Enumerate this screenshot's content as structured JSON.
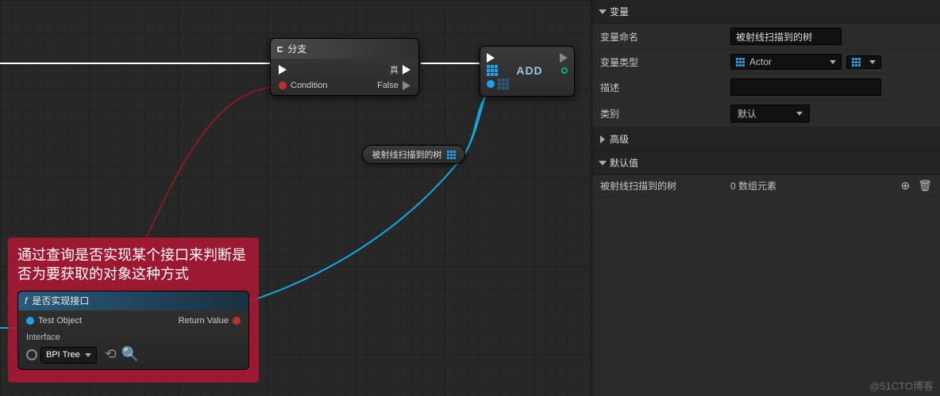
{
  "graph": {
    "branch": {
      "title": "分支",
      "condition": "Condition",
      "true": "真",
      "false": "False"
    },
    "add": {
      "label": "ADD"
    },
    "var_pill": "被射线扫描到的树",
    "note_text": "通过查询是否实现某个接口来判断是否为要获取的对象这种方式",
    "interface_check": {
      "title": "是否实现接口",
      "test_object": "Test Object",
      "return_value": "Return Value",
      "interface_label": "Interface",
      "interface_value": "BPI Tree"
    }
  },
  "details": {
    "sections": {
      "variable": "变量",
      "advanced": "高级",
      "default_val": "默认值"
    },
    "rows": {
      "name_label": "变量命名",
      "name_value": "被射线扫描到的树",
      "type_label": "变量类型",
      "type_value": "Actor",
      "desc_label": "描述",
      "desc_value": "",
      "category_label": "类别",
      "category_value": "默认",
      "default_name": "被射线扫描到的树",
      "default_count": "0 数组元素"
    }
  },
  "credit": "@51CTO博客"
}
